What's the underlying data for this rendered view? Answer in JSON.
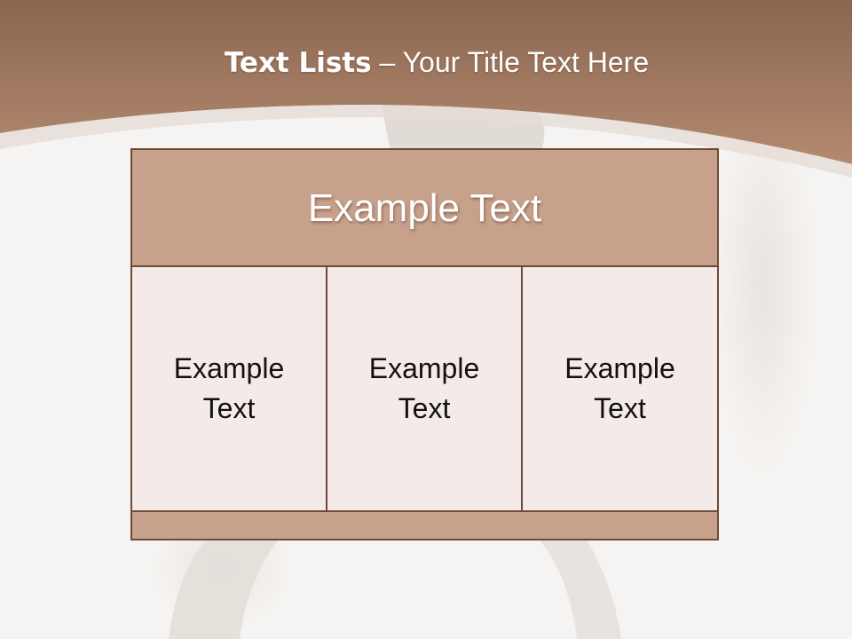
{
  "slide": {
    "title_bold": "Text Lists",
    "title_rest": " – Your Title Text Here"
  },
  "diagram": {
    "header": "Example Text",
    "cells": [
      "Example Text",
      "Example Text",
      "Example Text"
    ]
  },
  "colors": {
    "banner": "#a87a60",
    "header_fill": "#c7a18b",
    "cell_fill": "#f4ebe8",
    "border": "#6e4b38"
  }
}
